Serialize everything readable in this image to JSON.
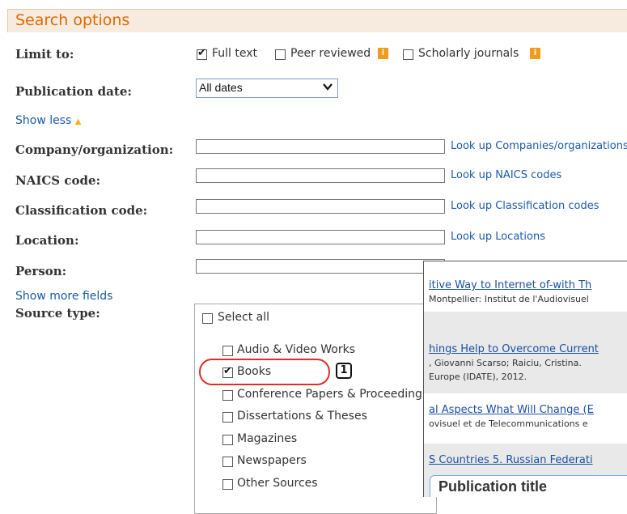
{
  "header": {
    "title": "Search options"
  },
  "limit": {
    "label": "Limit to:",
    "options": [
      {
        "label": "Full text",
        "checked": true
      },
      {
        "label": "Peer reviewed",
        "checked": false,
        "info": "i"
      },
      {
        "label": "Scholarly journals",
        "checked": false,
        "info": "i"
      }
    ]
  },
  "pubdate": {
    "label": "Publication date:",
    "value": "All dates"
  },
  "show_less": {
    "label": "Show less"
  },
  "fields": [
    {
      "label": "Company/organization:",
      "value": "",
      "lookup": "Look up Companies/organizations"
    },
    {
      "label": "NAICS code:",
      "value": "",
      "lookup": "Look up NAICS codes"
    },
    {
      "label": "Classification code:",
      "value": "",
      "lookup": "Look up Classification codes"
    },
    {
      "label": "Location:",
      "value": "",
      "lookup": "Look up Locations"
    },
    {
      "label": "Person:",
      "value": ""
    }
  ],
  "show_more": {
    "label": "Show more fields"
  },
  "source_type": {
    "label": "Source type:",
    "select_all": "Select all",
    "items": [
      {
        "label": "Audio & Video Works",
        "checked": false
      },
      {
        "label": "Books",
        "checked": true
      },
      {
        "label": "Conference Papers & Proceeding",
        "checked": false
      },
      {
        "label": "Dissertations & Theses",
        "checked": false
      },
      {
        "label": "Magazines",
        "checked": false
      },
      {
        "label": "Newspapers",
        "checked": false
      },
      {
        "label": "Other Sources",
        "checked": false
      }
    ]
  },
  "callout": {
    "number": "1"
  },
  "popup": {
    "results": [
      {
        "link": "itive Way to Internet of-with Th",
        "sub": "Montpellier: Institut de l'Audiovisuel"
      },
      {
        "link": "hings Help to Overcome Current",
        "sub": ", Giovanni Scarso; Raiciu, Cristina.",
        "sub2": " Europe (IDATE), 2012."
      },
      {
        "link": "al Aspects What Will Change (E",
        "sub": "ovisuel et de Telecommunications e"
      },
      {
        "link": "S Countries 5. Russian Federati"
      }
    ],
    "panel_title": "Publication title"
  }
}
